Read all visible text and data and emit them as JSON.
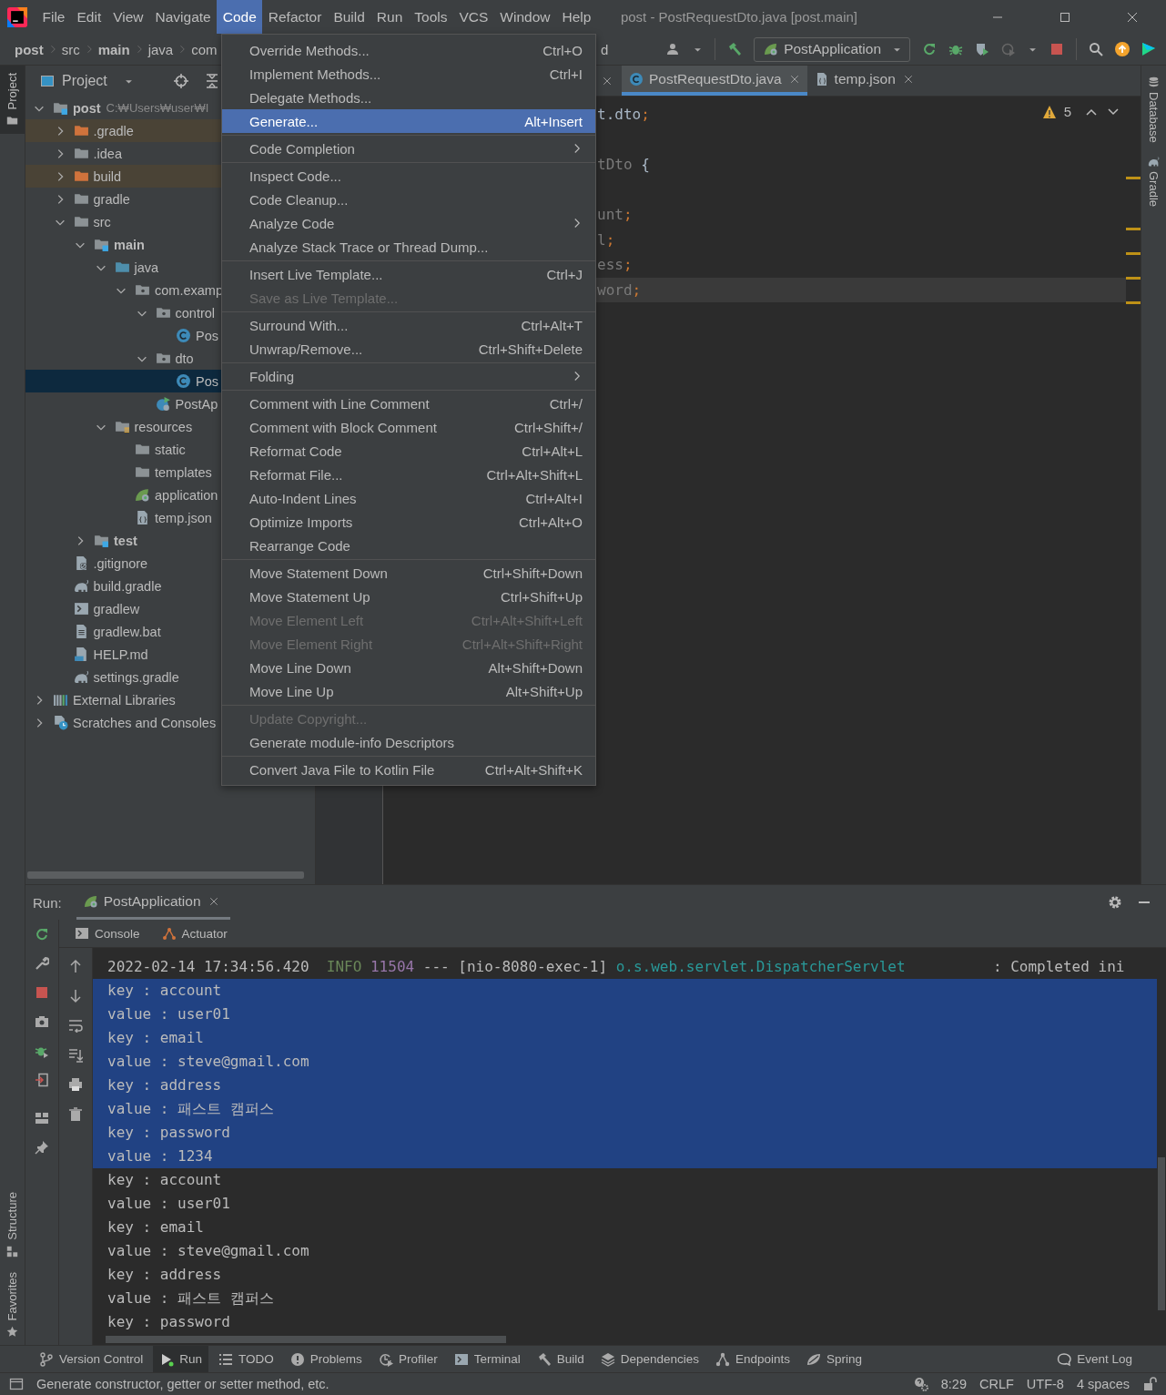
{
  "menubar": {
    "items": [
      {
        "label": "File",
        "selected": false
      },
      {
        "label": "Edit",
        "selected": false
      },
      {
        "label": "View",
        "selected": false
      },
      {
        "label": "Navigate",
        "selected": false
      },
      {
        "label": "Code",
        "selected": true
      },
      {
        "label": "Refactor",
        "selected": false
      },
      {
        "label": "Build",
        "selected": false
      },
      {
        "label": "Run",
        "selected": false
      },
      {
        "label": "Tools",
        "selected": false
      },
      {
        "label": "VCS",
        "selected": false
      },
      {
        "label": "Window",
        "selected": false
      },
      {
        "label": "Help",
        "selected": false
      }
    ],
    "title": "post - PostRequestDto.java [post.main]"
  },
  "breadcrumbs": [
    {
      "label": "post",
      "bold": true
    },
    {
      "label": "src",
      "bold": false
    },
    {
      "label": "main",
      "bold": true
    },
    {
      "label": "java",
      "bold": false
    },
    {
      "label": "com",
      "bold": false
    },
    {
      "label": "d",
      "bold": false
    }
  ],
  "toolbar": {
    "run_config": "PostApplication"
  },
  "left_strip": {
    "top": [
      {
        "label": "Project",
        "selected": true
      }
    ],
    "bottom": [
      {
        "label": "Structure",
        "selected": false
      },
      {
        "label": "Favorites",
        "selected": false
      }
    ]
  },
  "right_strip": [
    {
      "label": "Database",
      "selected": false
    },
    {
      "label": "Gradle",
      "selected": false
    }
  ],
  "project": {
    "title": "Project",
    "tree": [
      {
        "label": "post",
        "kind": "module",
        "bold": true,
        "path": "C:₩Users₩user₩I",
        "expanded": true,
        "selected": false,
        "children": [
          {
            "label": ".gradle",
            "kind": "folder",
            "expanded": false,
            "selected": false,
            "excluded": true
          },
          {
            "label": ".idea",
            "kind": "folder",
            "expanded": false,
            "selected": false
          },
          {
            "label": "build",
            "kind": "folder",
            "expanded": false,
            "selected": false,
            "excluded": true
          },
          {
            "label": "gradle",
            "kind": "folder",
            "expanded": false,
            "selected": false
          },
          {
            "label": "src",
            "kind": "folder",
            "expanded": true,
            "selected": false,
            "children": [
              {
                "label": "main",
                "kind": "module-folder",
                "bold": true,
                "expanded": true,
                "selected": false,
                "children": [
                  {
                    "label": "java",
                    "kind": "source-folder",
                    "expanded": true,
                    "selected": false,
                    "children": [
                      {
                        "label": "com.examp",
                        "kind": "package",
                        "expanded": true,
                        "selected": false,
                        "children": [
                          {
                            "label": "control",
                            "kind": "package",
                            "expanded": true,
                            "selected": false,
                            "children": [
                              {
                                "label": "Pos",
                                "kind": "class",
                                "selected": false
                              }
                            ]
                          },
                          {
                            "label": "dto",
                            "kind": "package",
                            "expanded": true,
                            "selected": false,
                            "children": [
                              {
                                "label": "Pos",
                                "kind": "class",
                                "selected": true
                              }
                            ]
                          },
                          {
                            "label": "PostAp",
                            "kind": "app-class",
                            "selected": false
                          }
                        ]
                      }
                    ]
                  },
                  {
                    "label": "resources",
                    "kind": "resources",
                    "expanded": true,
                    "selected": false,
                    "children": [
                      {
                        "label": "static",
                        "kind": "folder",
                        "selected": false
                      },
                      {
                        "label": "templates",
                        "kind": "folder",
                        "selected": false
                      },
                      {
                        "label": "application",
                        "kind": "spring-config",
                        "selected": false
                      },
                      {
                        "label": "temp.json",
                        "kind": "json",
                        "selected": false
                      }
                    ]
                  }
                ]
              },
              {
                "label": "test",
                "kind": "module-folder",
                "bold": true,
                "expanded": false,
                "selected": false
              }
            ]
          },
          {
            "label": ".gitignore",
            "kind": "ignore-file",
            "selected": false
          },
          {
            "label": "build.gradle",
            "kind": "gradle",
            "selected": false
          },
          {
            "label": "gradlew",
            "kind": "script",
            "selected": false
          },
          {
            "label": "gradlew.bat",
            "kind": "text-file",
            "selected": false
          },
          {
            "label": "HELP.md",
            "kind": "markdown",
            "selected": false
          },
          {
            "label": "settings.gradle",
            "kind": "gradle",
            "selected": false
          }
        ]
      },
      {
        "label": "External Libraries",
        "kind": "libraries",
        "expanded": false,
        "selected": false
      },
      {
        "label": "Scratches and Consoles",
        "kind": "scratches",
        "expanded": false,
        "selected": false
      }
    ]
  },
  "editor": {
    "tabs": [
      {
        "label": "PostRequestDto.java",
        "kind": "class",
        "selected": true
      },
      {
        "label": "temp.json",
        "kind": "json",
        "selected": false
      }
    ],
    "warnings": "5",
    "lines": [
      {
        "blank_before": false,
        "current": false,
        "segments": [
          {
            "kind": "text",
            "text": "t.dto"
          },
          {
            "kind": "punct",
            "text": ";"
          }
        ]
      },
      {
        "blank_before": true,
        "current": false,
        "segments": [
          {
            "kind": "dim",
            "text": "tDto"
          },
          {
            "kind": "text",
            "text": " {"
          }
        ]
      },
      {
        "blank_before": true,
        "current": false,
        "segments": [
          {
            "kind": "dim",
            "text": "unt"
          },
          {
            "kind": "punct",
            "text": ";"
          }
        ]
      },
      {
        "blank_before": false,
        "current": false,
        "segments": [
          {
            "kind": "dim",
            "text": "l"
          },
          {
            "kind": "punct",
            "text": ";"
          }
        ]
      },
      {
        "blank_before": false,
        "current": false,
        "segments": [
          {
            "kind": "dim",
            "text": "ess"
          },
          {
            "kind": "punct",
            "text": ";"
          }
        ]
      },
      {
        "blank_before": false,
        "current": true,
        "segments": [
          {
            "kind": "dim",
            "text": "word"
          },
          {
            "kind": "punct",
            "text": ";"
          }
        ]
      }
    ]
  },
  "code_menu": {
    "groups": [
      {
        "items": [
          {
            "label": "Override Methods...",
            "shortcut": "Ctrl+O",
            "selected": false,
            "disabled": false,
            "submenu": false
          },
          {
            "label": "Implement Methods...",
            "shortcut": "Ctrl+I",
            "selected": false,
            "disabled": false,
            "submenu": false
          },
          {
            "label": "Delegate Methods...",
            "selected": false,
            "disabled": false,
            "submenu": false
          },
          {
            "label": "Generate...",
            "shortcut": "Alt+Insert",
            "selected": true,
            "disabled": false,
            "submenu": false
          }
        ]
      },
      {
        "items": [
          {
            "label": "Code Completion",
            "selected": false,
            "disabled": false,
            "submenu": true
          }
        ]
      },
      {
        "items": [
          {
            "label": "Inspect Code...",
            "selected": false,
            "disabled": false,
            "submenu": false
          },
          {
            "label": "Code Cleanup...",
            "selected": false,
            "disabled": false,
            "submenu": false
          },
          {
            "label": "Analyze Code",
            "selected": false,
            "disabled": false,
            "submenu": true
          },
          {
            "label": "Analyze Stack Trace or Thread Dump...",
            "selected": false,
            "disabled": false,
            "submenu": false
          }
        ]
      },
      {
        "items": [
          {
            "label": "Insert Live Template...",
            "shortcut": "Ctrl+J",
            "selected": false,
            "disabled": false,
            "submenu": false
          },
          {
            "label": "Save as Live Template...",
            "selected": false,
            "disabled": true,
            "submenu": false
          }
        ]
      },
      {
        "items": [
          {
            "label": "Surround With...",
            "shortcut": "Ctrl+Alt+T",
            "selected": false,
            "disabled": false,
            "submenu": false
          },
          {
            "label": "Unwrap/Remove...",
            "shortcut": "Ctrl+Shift+Delete",
            "selected": false,
            "disabled": false,
            "submenu": false
          }
        ]
      },
      {
        "items": [
          {
            "label": "Folding",
            "selected": false,
            "disabled": false,
            "submenu": true
          }
        ]
      },
      {
        "items": [
          {
            "label": "Comment with Line Comment",
            "shortcut": "Ctrl+/",
            "selected": false,
            "disabled": false,
            "submenu": false
          },
          {
            "label": "Comment with Block Comment",
            "shortcut": "Ctrl+Shift+/",
            "selected": false,
            "disabled": false,
            "submenu": false
          },
          {
            "label": "Reformat Code",
            "shortcut": "Ctrl+Alt+L",
            "selected": false,
            "disabled": false,
            "submenu": false
          },
          {
            "label": "Reformat File...",
            "shortcut": "Ctrl+Alt+Shift+L",
            "selected": false,
            "disabled": false,
            "submenu": false
          },
          {
            "label": "Auto-Indent Lines",
            "shortcut": "Ctrl+Alt+I",
            "selected": false,
            "disabled": false,
            "submenu": false
          },
          {
            "label": "Optimize Imports",
            "shortcut": "Ctrl+Alt+O",
            "selected": false,
            "disabled": false,
            "submenu": false
          },
          {
            "label": "Rearrange Code",
            "selected": false,
            "disabled": false,
            "submenu": false
          }
        ]
      },
      {
        "items": [
          {
            "label": "Move Statement Down",
            "shortcut": "Ctrl+Shift+Down",
            "selected": false,
            "disabled": false,
            "submenu": false
          },
          {
            "label": "Move Statement Up",
            "shortcut": "Ctrl+Shift+Up",
            "selected": false,
            "disabled": false,
            "submenu": false
          },
          {
            "label": "Move Element Left",
            "shortcut": "Ctrl+Alt+Shift+Left",
            "selected": false,
            "disabled": true,
            "submenu": false
          },
          {
            "label": "Move Element Right",
            "shortcut": "Ctrl+Alt+Shift+Right",
            "selected": false,
            "disabled": true,
            "submenu": false
          },
          {
            "label": "Move Line Down",
            "shortcut": "Alt+Shift+Down",
            "selected": false,
            "disabled": false,
            "submenu": false
          },
          {
            "label": "Move Line Up",
            "shortcut": "Alt+Shift+Up",
            "selected": false,
            "disabled": false,
            "submenu": false
          }
        ]
      },
      {
        "items": [
          {
            "label": "Update Copyright...",
            "selected": false,
            "disabled": true,
            "submenu": false
          },
          {
            "label": "Generate module-info Descriptors",
            "selected": false,
            "disabled": false,
            "submenu": false
          }
        ]
      },
      {
        "items": [
          {
            "label": "Convert Java File to Kotlin File",
            "shortcut": "Ctrl+Alt+Shift+K",
            "selected": false,
            "disabled": false,
            "submenu": false
          }
        ]
      }
    ]
  },
  "run_panel": {
    "label": "Run:",
    "tabs": [
      {
        "label": "PostApplication",
        "selected": true
      }
    ],
    "subtabs": [
      "Console",
      "Actuator"
    ],
    "console": [
      {
        "kind": "log",
        "selected": false,
        "segments": [
          {
            "kind": "date",
            "text": "2022-02-14 17:34:56.420"
          },
          {
            "kind": "level",
            "text": "INFO"
          },
          {
            "kind": "pid",
            "text": "11504"
          },
          {
            "kind": "plain",
            "text": "---"
          },
          {
            "kind": "plain",
            "text": "[nio-8080-exec-1]"
          },
          {
            "kind": "logger",
            "text": "o.s.web.servlet.DispatcherServlet"
          },
          {
            "kind": "plain",
            "text": ": Completed ini"
          }
        ]
      },
      {
        "kind": "text",
        "selected": true,
        "text": "key : account"
      },
      {
        "kind": "text",
        "selected": true,
        "text": "value : user01"
      },
      {
        "kind": "text",
        "selected": true,
        "text": "key : email"
      },
      {
        "kind": "text",
        "selected": true,
        "text": "value : steve@gmail.com"
      },
      {
        "kind": "text",
        "selected": true,
        "text": "key : address"
      },
      {
        "kind": "text",
        "selected": true,
        "text": "value : 패스트 캠퍼스"
      },
      {
        "kind": "text",
        "selected": true,
        "text": "key : password"
      },
      {
        "kind": "text",
        "selected": true,
        "text": "value : 1234"
      },
      {
        "kind": "text",
        "selected": false,
        "text": "key : account"
      },
      {
        "kind": "text",
        "selected": false,
        "text": "value : user01"
      },
      {
        "kind": "text",
        "selected": false,
        "text": "key : email"
      },
      {
        "kind": "text",
        "selected": false,
        "text": "value : steve@gmail.com"
      },
      {
        "kind": "text",
        "selected": false,
        "text": "key : address"
      },
      {
        "kind": "text",
        "selected": false,
        "text": "value : 패스트 캠퍼스"
      },
      {
        "kind": "text",
        "selected": false,
        "text": "key : password"
      }
    ]
  },
  "tool_windows": {
    "left": [
      {
        "label": "Version Control",
        "selected": false
      },
      {
        "label": "Run",
        "selected": true
      },
      {
        "label": "TODO",
        "selected": false
      },
      {
        "label": "Problems",
        "selected": false
      },
      {
        "label": "Profiler",
        "selected": false
      },
      {
        "label": "Terminal",
        "selected": false
      },
      {
        "label": "Build",
        "selected": false
      },
      {
        "label": "Dependencies",
        "selected": false
      },
      {
        "label": "Endpoints",
        "selected": false
      },
      {
        "label": "Spring",
        "selected": false
      }
    ],
    "right": [
      {
        "label": "Event Log",
        "selected": false
      }
    ]
  },
  "status_bar": {
    "message": "Generate constructor, getter or setter method, etc.",
    "position": "8:29",
    "line_separator": "CRLF",
    "encoding": "UTF-8",
    "indent": "4 spaces"
  }
}
